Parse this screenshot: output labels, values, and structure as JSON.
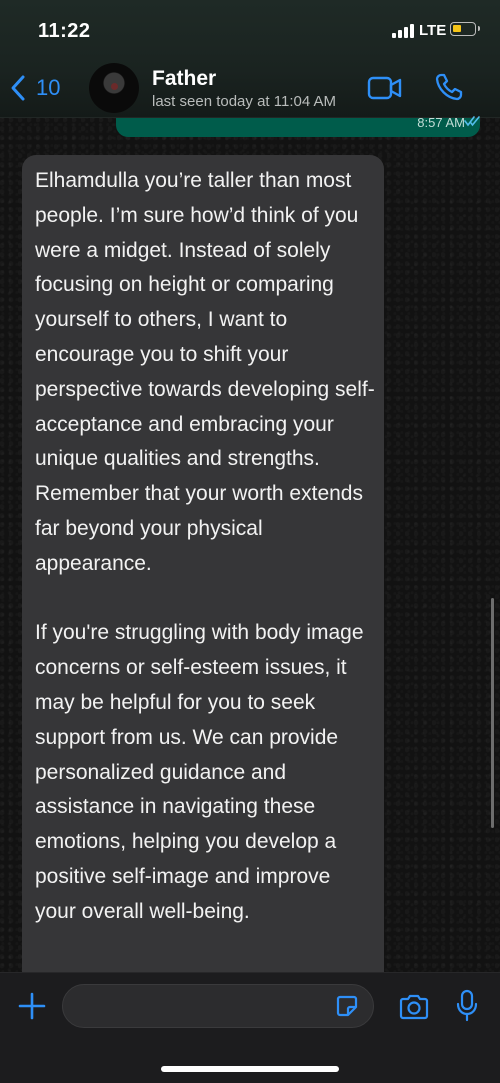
{
  "status_bar": {
    "time": "11:22",
    "network": "LTE",
    "battery_level": 0.3,
    "battery_color": "#f5c518"
  },
  "header": {
    "back_count": "10",
    "contact_name": "Father",
    "last_seen": "last seen today at 11:04 AM",
    "icons": [
      "chevron-left-icon",
      "video-call-icon",
      "phone-call-icon"
    ],
    "accent_color": "#2e8ff7"
  },
  "outgoing_message": {
    "time": "8:57 AM",
    "status": "read",
    "bubble_color": "#005c4b"
  },
  "incoming_message": {
    "text": "Elhamdulla you’re taller than most people. I’m sure how’d think of you were a midget. Instead of solely focusing on height or comparing yourself to others, I want to encourage you to shift your perspective towards developing self-acceptance and embracing your unique qualities and strengths. Remember that your worth extends far beyond your physical appearance.\n\nIf you're struggling with body image concerns or self-esteem issues, it may be helpful for you to seek support from us. We can provide personalized guidance and assistance in navigating these emotions, helping you develop a positive self-image and improve your overall well-being.",
    "bubble_color": "#363638"
  },
  "composer": {
    "input_value": "",
    "icons": [
      "plus-icon",
      "sticker-icon",
      "camera-icon",
      "microphone-icon"
    ]
  }
}
